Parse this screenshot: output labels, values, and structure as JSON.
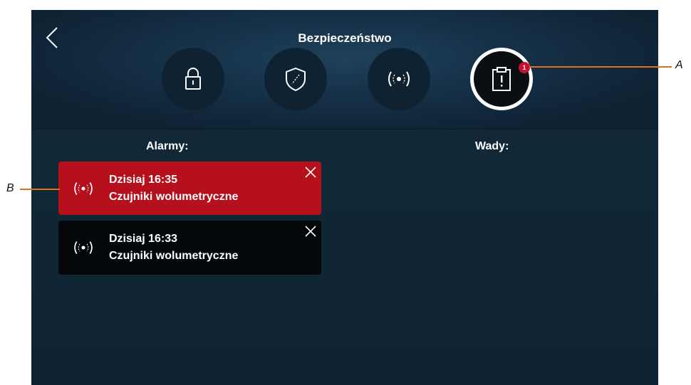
{
  "header": {
    "title": "Bezpieczeństwo",
    "tabs": [
      {
        "id": "lock",
        "icon": "lock-icon",
        "active": false
      },
      {
        "id": "shield",
        "icon": "shield-icon",
        "active": false
      },
      {
        "id": "sensor",
        "icon": "sensor-icon",
        "active": false
      },
      {
        "id": "faults",
        "icon": "clipboard-alert-icon",
        "active": true,
        "badge": "1"
      }
    ]
  },
  "columns": {
    "alarms_title": "Alarmy:",
    "faults_title": "Wady:"
  },
  "alarms": [
    {
      "time": "Dzisiaj 16:35",
      "name": "Czujniki wolumetryczne",
      "icon": "sensor-icon",
      "state": "active"
    },
    {
      "time": "Dzisiaj 16:33",
      "name": "Czujniki wolumetryczne",
      "icon": "sensor-icon",
      "state": "inactive"
    }
  ],
  "callouts": {
    "a": "A",
    "b": "B"
  },
  "colors": {
    "accent_red": "#b5101c",
    "callout_line": "#e0701c",
    "badge": "#c8102e"
  }
}
